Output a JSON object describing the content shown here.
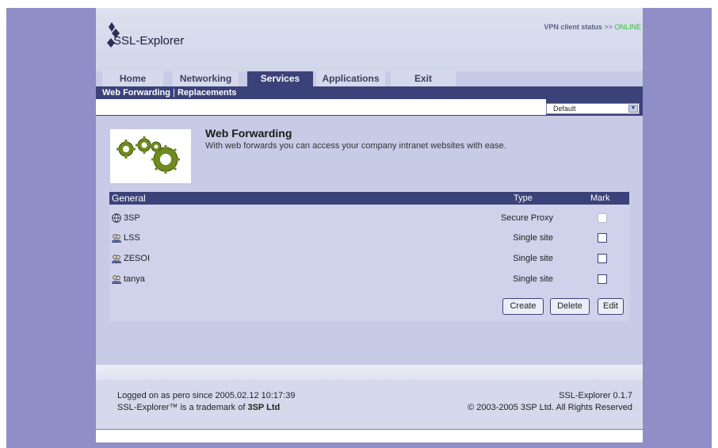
{
  "header": {
    "logo_text": "SSL-Explorer",
    "vpn_label": "VPN client status",
    "vpn_separator": ">>",
    "vpn_status": "ONLINE"
  },
  "tabs": [
    {
      "label": "Home",
      "active": false
    },
    {
      "label": "Networking",
      "active": false
    },
    {
      "label": "Services",
      "active": true
    },
    {
      "label": "Applications",
      "active": false
    },
    {
      "label": "Exit",
      "active": false
    }
  ],
  "subnav": {
    "web_forwarding": "Web Forwarding",
    "separator": "|",
    "replacements": "Replacements"
  },
  "theme_select": {
    "value": "Default"
  },
  "intro": {
    "title": "Web Forwarding",
    "description": "With web forwards you can access your company intranet websites with ease."
  },
  "table": {
    "headers": {
      "general": "General",
      "type": "Type",
      "mark": "Mark"
    },
    "rows": [
      {
        "name": "3SP",
        "type": "Secure Proxy",
        "icon": "globe-icon",
        "mark_enabled": false
      },
      {
        "name": "LSS",
        "type": "Single site",
        "icon": "users-icon",
        "mark_enabled": true
      },
      {
        "name": "ZESOI",
        "type": "Single site",
        "icon": "users-icon",
        "mark_enabled": true
      },
      {
        "name": "tanya",
        "type": "Single site",
        "icon": "users-icon",
        "mark_enabled": true
      }
    ],
    "buttons": {
      "create": "Create",
      "delete": "Delete",
      "edit": "Edit"
    }
  },
  "footer": {
    "logged_on": "Logged on as pero since 2005.02.12 10:17:39",
    "trademark_prefix": "SSL-Explorer™ is a trademark of",
    "trademark_company": "3SP Ltd",
    "version": "SSL-Explorer 0.1.7",
    "copyright": "© 2003-2005 3SP Ltd. All Rights Reserved"
  },
  "colors": {
    "frame": "#8f8ec7",
    "nav_dark": "#3b427a",
    "content": "#c8cbe6",
    "online": "#2bbf2b"
  }
}
